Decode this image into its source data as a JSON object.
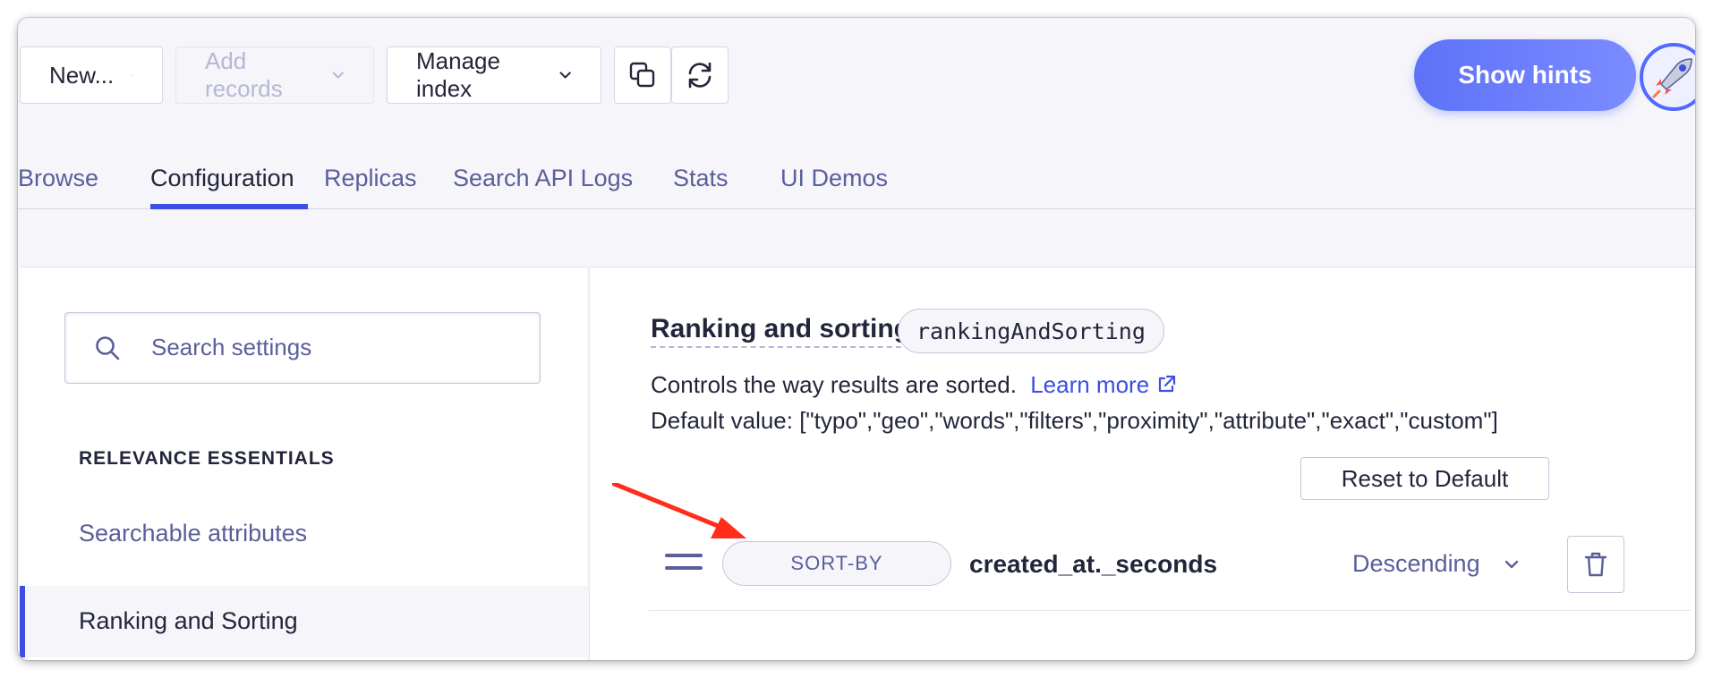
{
  "toolbar": {
    "new_label": "New...",
    "add_records_label": "Add records",
    "manage_index_label": "Manage index",
    "show_hints_label": "Show hints"
  },
  "tabs": [
    {
      "label": "Browse"
    },
    {
      "label": "Configuration"
    },
    {
      "label": "Replicas"
    },
    {
      "label": "Search API Logs"
    },
    {
      "label": "Stats"
    },
    {
      "label": "UI Demos"
    }
  ],
  "sidebar": {
    "search_placeholder": "Search settings",
    "section_heading": "RELEVANCE ESSENTIALS",
    "items": [
      {
        "label": "Searchable attributes"
      },
      {
        "label": "Ranking and Sorting"
      }
    ]
  },
  "main": {
    "title": "Ranking and sorting",
    "tag": "rankingAndSorting",
    "description": "Controls the way results are sorted.",
    "learn_more": "Learn more",
    "default_value": "Default value: [\"typo\",\"geo\",\"words\",\"filters\",\"proximity\",\"attribute\",\"exact\",\"custom\"]",
    "reset_label": "Reset to Default",
    "criteria": [
      {
        "type": "SORT-BY",
        "attribute": "created_at._seconds",
        "order": "Descending"
      }
    ]
  },
  "colors": {
    "accent": "#3c4fe0",
    "hint_button": "#5e72f8",
    "annotation_arrow": "#ff2d1a"
  }
}
